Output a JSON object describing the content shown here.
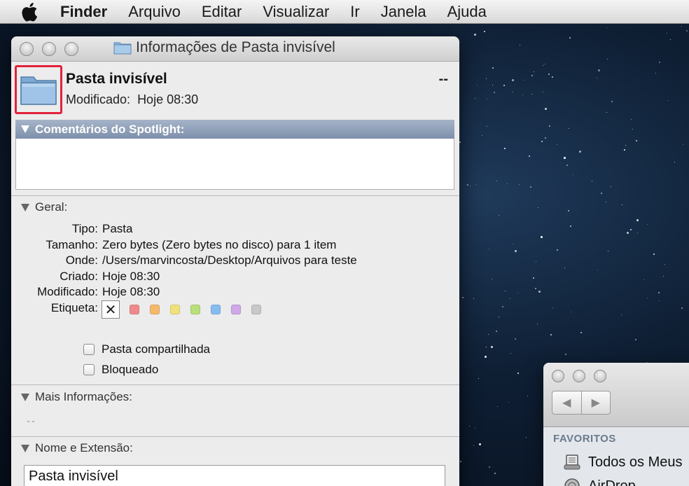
{
  "menubar": {
    "apple_icon": "apple-logo",
    "app_name": "Finder",
    "items": [
      "Arquivo",
      "Editar",
      "Visualizar",
      "Ir",
      "Janela",
      "Ajuda"
    ]
  },
  "info_window": {
    "title": "Informações de Pasta invisível",
    "file_name": "Pasta invisível",
    "modified_label": "Modificado:",
    "modified_value": "Hoje 08:30",
    "size_summary": "--",
    "spotlight_header": "Comentários do Spotlight:",
    "general_header": "Geral:",
    "properties": [
      {
        "label": "Tipo:",
        "value": "Pasta"
      },
      {
        "label": "Tamanho:",
        "value": "Zero bytes (Zero bytes no disco) para 1 item"
      },
      {
        "label": "Onde:",
        "value": "/Users/marvincosta/Desktop/Arquivos para teste"
      },
      {
        "label": "Criado:",
        "value": "Hoje 08:30"
      },
      {
        "label": "Modificado:",
        "value": "Hoje 08:30"
      },
      {
        "label": "Etiqueta:",
        "value": ""
      }
    ],
    "label_none_glyph": "✕",
    "label_colors": [
      "#f08a8a",
      "#f5b96b",
      "#f0e27a",
      "#b9df7a",
      "#86bdf0",
      "#cfa8e8",
      "#c8c8c8"
    ],
    "checkboxes": [
      {
        "label": "Pasta compartilhada",
        "checked": false
      },
      {
        "label": "Bloqueado",
        "checked": false
      }
    ],
    "more_info_header": "Mais Informações:",
    "more_info_value": "--",
    "name_ext_header": "Nome e Extensão:",
    "name_field_value": "Pasta invisível",
    "highlight_color": "#e2223c"
  },
  "finder_window": {
    "back_glyph": "◀",
    "forward_glyph": "▶",
    "sidebar_header": "FAVORITOS",
    "sidebar_items": [
      "Todos os Meus",
      "AirDrop"
    ]
  }
}
